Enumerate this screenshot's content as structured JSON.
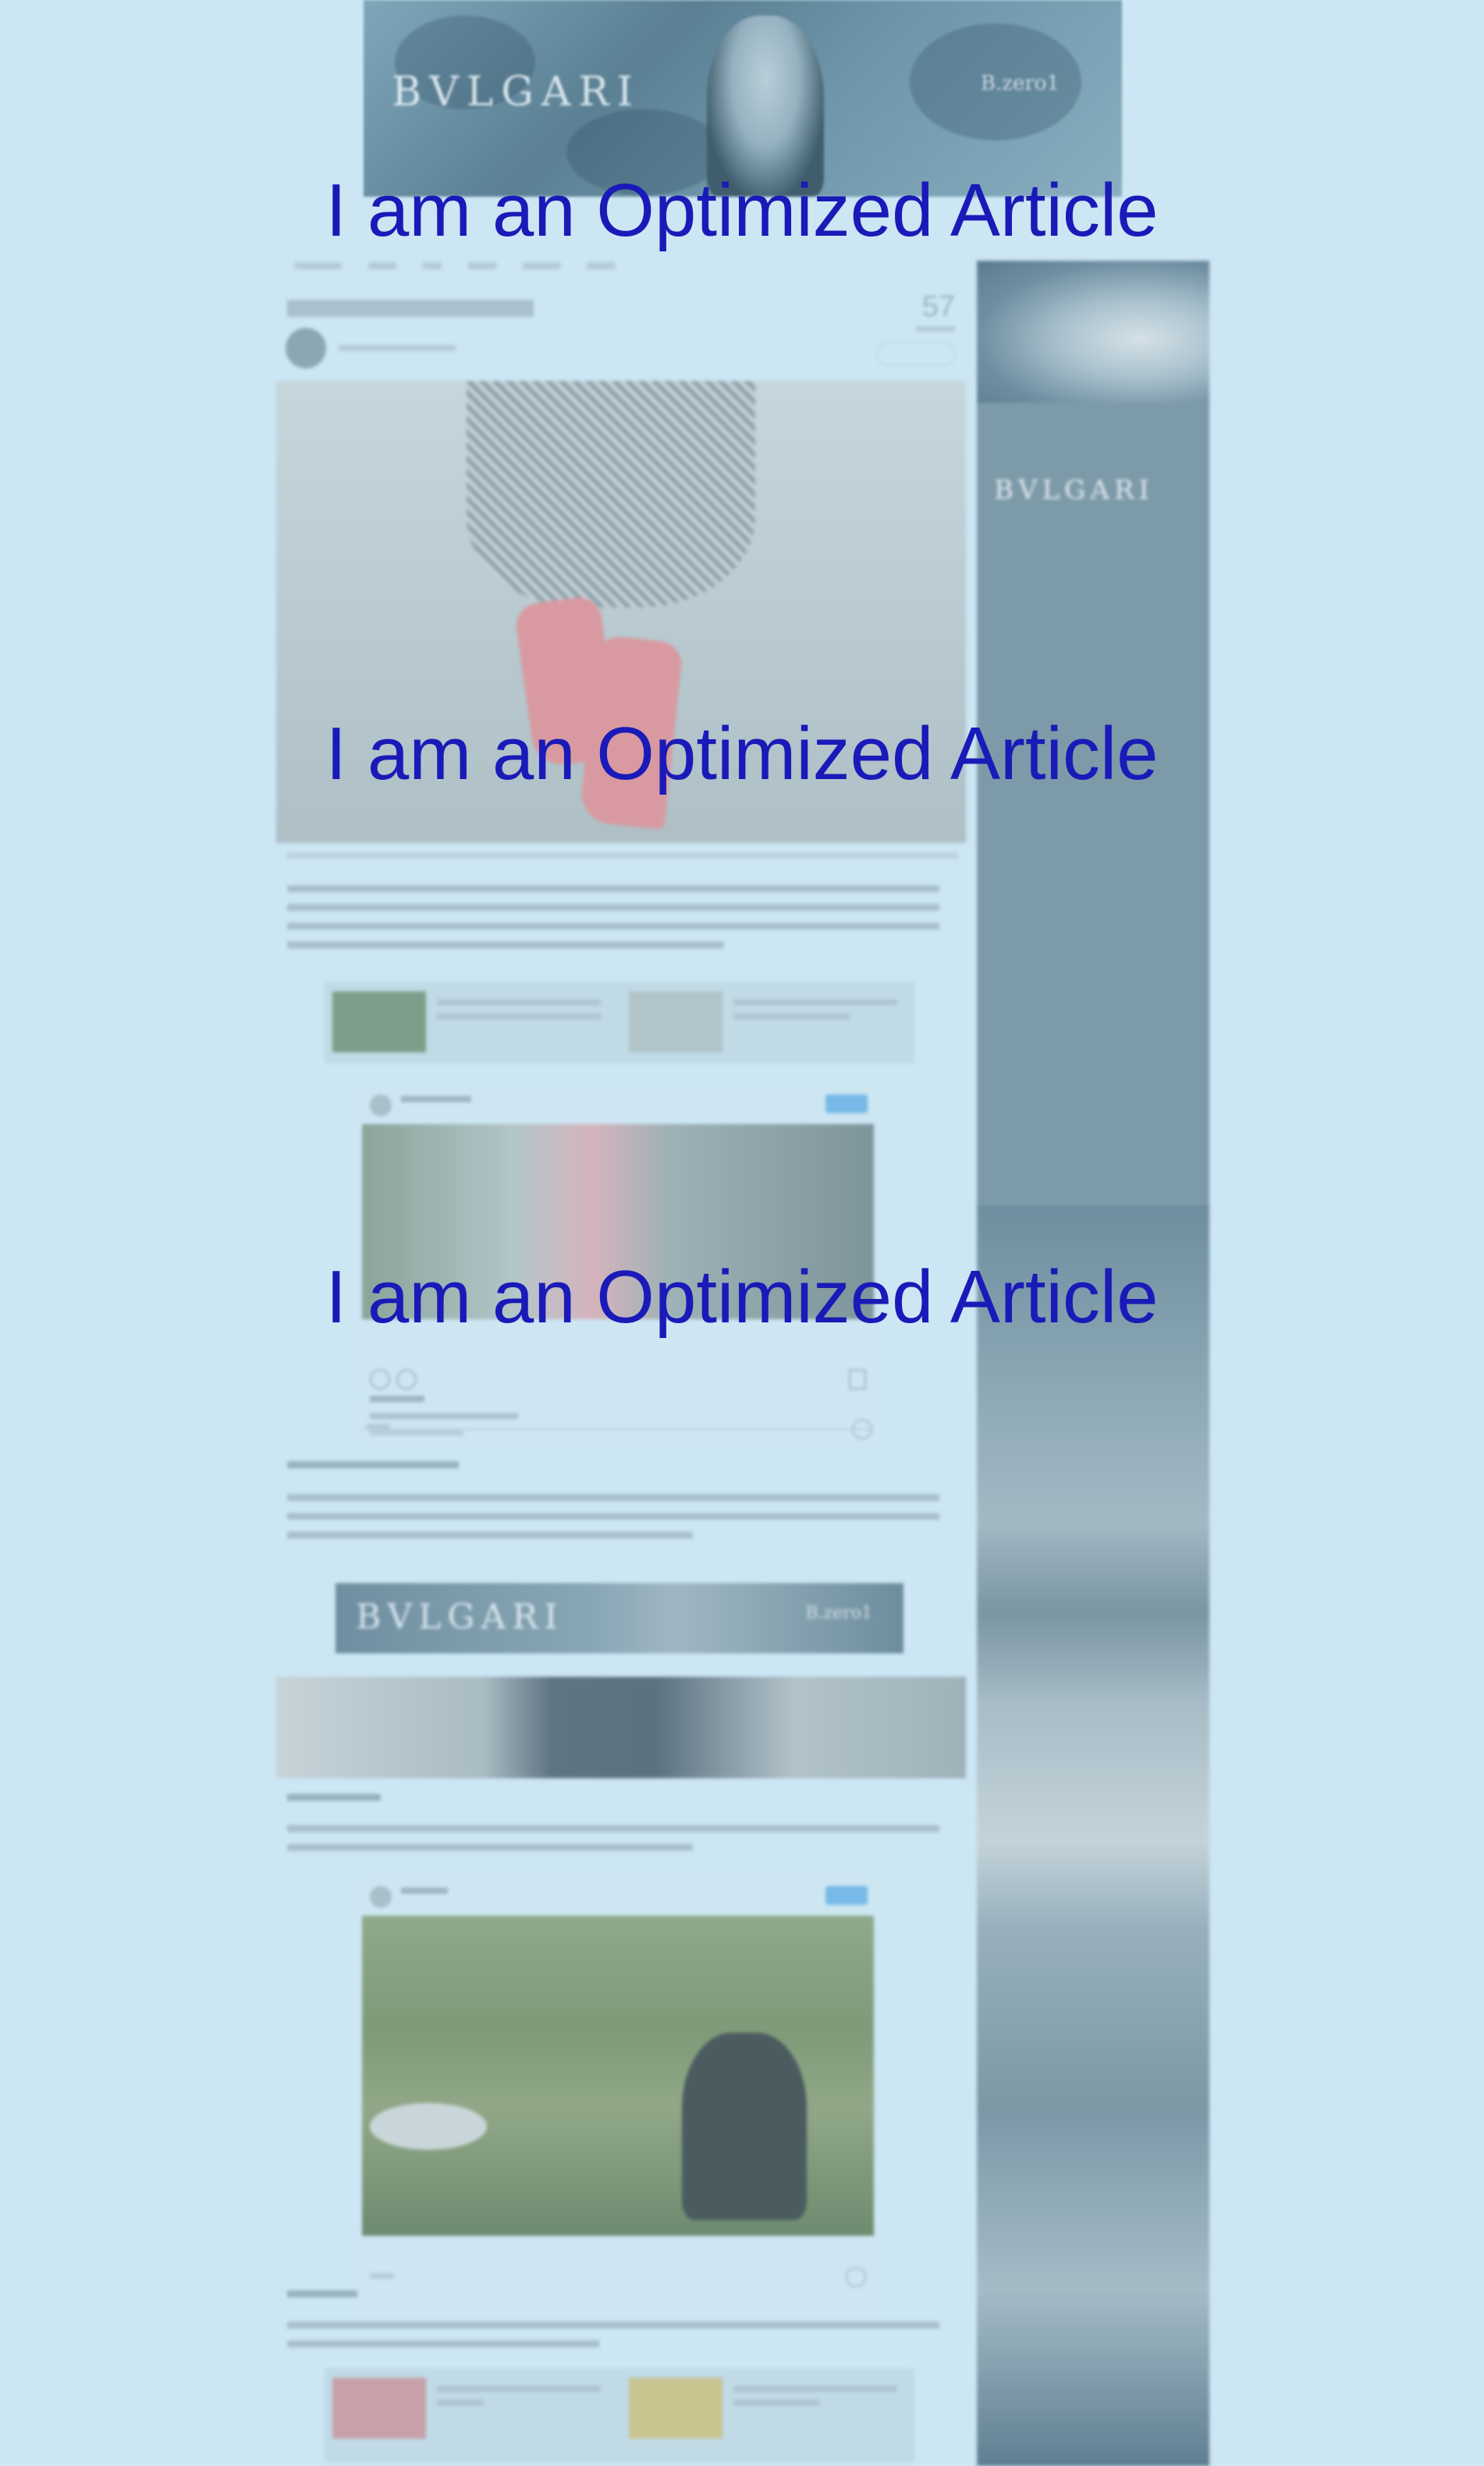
{
  "overlay": {
    "headline_1": "I am an Optimized Article",
    "headline_2": "I am an Optimized Article",
    "headline_3": "I am an Optimized Article"
  },
  "top_banner": {
    "brand": "BVLGARI",
    "sub_brand": "B.zero1"
  },
  "mid_banner": {
    "brand": "BVLGARI",
    "sub_brand": "B.zero1"
  },
  "sidebar_ad": {
    "brand": "BVLGARI"
  },
  "article": {
    "views": "57"
  },
  "colors": {
    "page_background": "#cce6f4",
    "overlay_text": "#1a1ab8",
    "follow_button": "#77b9e8"
  }
}
